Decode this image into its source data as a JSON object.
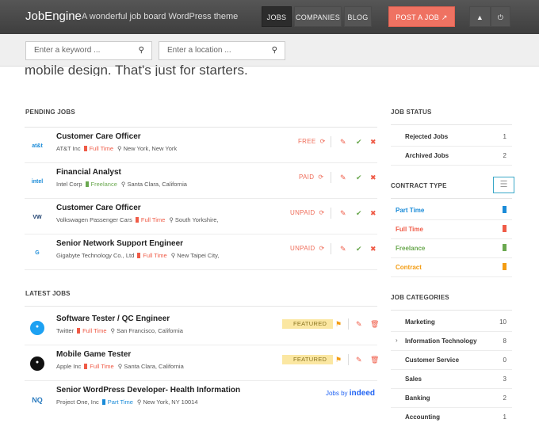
{
  "header": {
    "logo": "JobEngine",
    "tagline": "A wonderful job board WordPress theme",
    "nav": {
      "jobs": "JOBS",
      "companies": "COMPANIES",
      "blog": "BLOG",
      "post_job": "POST A JOB ↗"
    }
  },
  "search": {
    "keyword_placeholder": "Enter a keyword ...",
    "location_placeholder": "Enter a location ..."
  },
  "hero_text": "mobile design. That's just for starters.",
  "pending": {
    "heading": "PENDING JOBS",
    "jobs": [
      {
        "title": "Customer Care Officer",
        "company": "AT&T Inc",
        "type": "Full Time",
        "location": "New York, New York",
        "status": "FREE",
        "logo": "at&t"
      },
      {
        "title": "Financial Analyst",
        "company": "Intel Corp",
        "type": "Freelance",
        "location": "Santa Clara, California",
        "status": "PAID",
        "logo": "intel"
      },
      {
        "title": "Customer Care Officer",
        "company": "Volkswagen Passenger Cars",
        "type": "Full Time",
        "location": "South Yorkshire,",
        "status": "UNPAID",
        "logo": "VW"
      },
      {
        "title": "Senior Network Support Engineer",
        "company": "Gigabyte Technology Co., Ltd",
        "type": "Full Time",
        "location": "New Taipei City,",
        "status": "UNPAID",
        "logo": "G"
      }
    ]
  },
  "latest": {
    "heading": "LATEST JOBS",
    "jobs": [
      {
        "title": "Software Tester / QC Engineer",
        "company": "Twitter",
        "type": "Full Time",
        "location": "San Francisco, California",
        "badge": "FEATURED"
      },
      {
        "title": "Mobile Game Tester",
        "company": "Apple Inc",
        "type": "Full Time",
        "location": "Santa Clara, California",
        "badge": "FEATURED"
      },
      {
        "title": "Senior WordPress Developer- Health Information",
        "company": "Project One, Inc",
        "type": "Part Time",
        "location": "New York, NY 10014",
        "source_prefix": "Jobs by",
        "source_brand": "indeed"
      }
    ]
  },
  "sidebar": {
    "job_status": {
      "heading": "JOB STATUS",
      "items": [
        {
          "label": "Rejected Jobs",
          "count": "1"
        },
        {
          "label": "Archived Jobs",
          "count": "2"
        }
      ]
    },
    "contract_type": {
      "heading": "CONTRACT TYPE",
      "items": [
        {
          "label": "Part Time",
          "color": "#1a8bd8"
        },
        {
          "label": "Full Time",
          "color": "#ef5b47"
        },
        {
          "label": "Freelance",
          "color": "#6aa84f"
        },
        {
          "label": "Contract",
          "color": "#f39c12"
        }
      ]
    },
    "categories": {
      "heading": "JOB CATEGORIES",
      "items": [
        {
          "label": "Marketing",
          "count": "10"
        },
        {
          "label": "Information Technology",
          "count": "8"
        },
        {
          "label": "Customer Service",
          "count": "0"
        },
        {
          "label": "Sales",
          "count": "3"
        },
        {
          "label": "Banking",
          "count": "2"
        },
        {
          "label": "Accounting",
          "count": "1"
        }
      ]
    }
  }
}
